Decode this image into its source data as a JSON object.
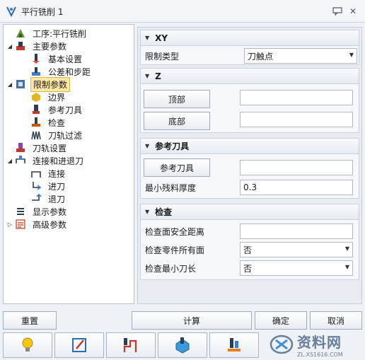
{
  "window": {
    "title": "平行铣削 1"
  },
  "tree": {
    "items": [
      {
        "label": "工序:平行铣削",
        "icon": "operation-icon",
        "twisty": ""
      },
      {
        "label": "主要参数",
        "icon": "main-params-icon",
        "twisty": "◢"
      },
      {
        "label": "基本设置",
        "icon": "basic-settings-icon",
        "twisty": ""
      },
      {
        "label": "公差和步距",
        "icon": "tolerance-icon",
        "twisty": ""
      },
      {
        "label": "限制参数",
        "icon": "limit-params-icon",
        "twisty": "◢"
      },
      {
        "label": "边界",
        "icon": "boundary-icon",
        "twisty": ""
      },
      {
        "label": "参考刀具",
        "icon": "reference-tool-icon",
        "twisty": ""
      },
      {
        "label": "检查",
        "icon": "check-icon",
        "twisty": ""
      },
      {
        "label": "刀轨过滤",
        "icon": "toolpath-filter-icon",
        "twisty": ""
      },
      {
        "label": "刀轨设置",
        "icon": "toolpath-settings-icon",
        "twisty": ""
      },
      {
        "label": "连接和进退刀",
        "icon": "link-icon",
        "twisty": "◢"
      },
      {
        "label": "连接",
        "icon": "connect-icon",
        "twisty": ""
      },
      {
        "label": "进刀",
        "icon": "lead-in-icon",
        "twisty": ""
      },
      {
        "label": "退刀",
        "icon": "lead-out-icon",
        "twisty": ""
      },
      {
        "label": "显示参数",
        "icon": "display-params-icon",
        "twisty": ""
      },
      {
        "label": "高级参数",
        "icon": "advanced-params-icon",
        "twisty": "▷"
      }
    ]
  },
  "groups": {
    "xy": {
      "title": "XY",
      "limit_type_label": "限制类型",
      "limit_type_value": "刀触点"
    },
    "z": {
      "title": "Z",
      "top_button": "顶部",
      "top_value": "",
      "bottom_button": "底部",
      "bottom_value": ""
    },
    "ref_tool": {
      "title": "参考刀具",
      "tool_button": "参考刀具",
      "tool_value": "",
      "min_residual_label": "最小残料厚度",
      "min_residual_value": "0.3"
    },
    "check": {
      "title": "检查",
      "safe_distance_label": "检查面安全距离",
      "safe_distance_value": "",
      "all_faces_label": "检查零件所有面",
      "all_faces_value": "否",
      "min_length_label": "检查最小刀长",
      "min_length_value": "否"
    }
  },
  "buttons": {
    "reset": "重置",
    "compute": "计算",
    "ok": "确定",
    "cancel": "取消"
  },
  "watermark": {
    "name": "资料网",
    "url": "ZL.XS1616.COM"
  }
}
